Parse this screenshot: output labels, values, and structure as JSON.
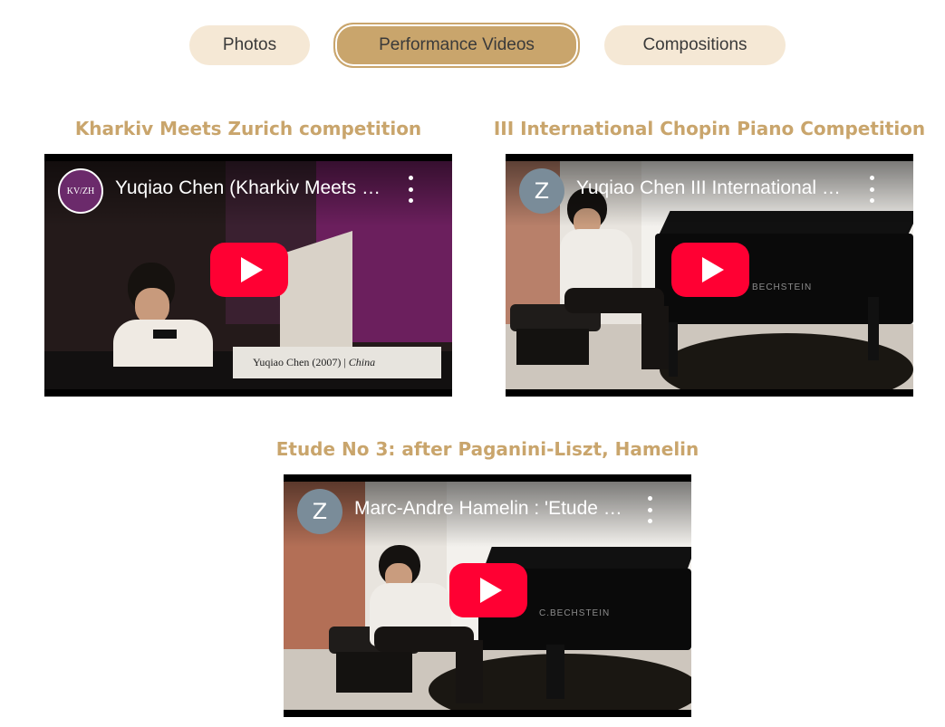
{
  "tabs": [
    {
      "label": "Photos",
      "active": false
    },
    {
      "label": "Performance Videos",
      "active": true
    },
    {
      "label": "Compositions",
      "active": false
    }
  ],
  "videos": [
    {
      "heading": "Kharkiv Meets Zurich competition",
      "channel_avatar": "KV/ZH",
      "video_title": "Yuqiao Chen (Kharkiv Meets Zurich...",
      "lower_third_name": "Yuqiao Chen (2007) | ",
      "lower_third_country": "China"
    },
    {
      "heading": "III International Chopin Piano Competition",
      "channel_avatar": "Z",
      "video_title": "Yuqiao Chen III International Chopin...",
      "piano_brand": "BECHSTEIN"
    },
    {
      "heading": "Etude No 3: after Paganini-Liszt, Hamelin",
      "channel_avatar": "Z",
      "video_title": "Marc-Andre Hamelin : 'Etude No 3...",
      "piano_brand": "C.BECHSTEIN"
    }
  ],
  "colors": {
    "accent_gold": "#c9a56c",
    "tab_bg": "#f5e8d5",
    "youtube_red": "#ff0033",
    "avatar_purple": "#6b2a6b",
    "avatar_gray": "#7a8c99"
  },
  "icons": [
    "play-icon",
    "more-vertical-icon"
  ]
}
